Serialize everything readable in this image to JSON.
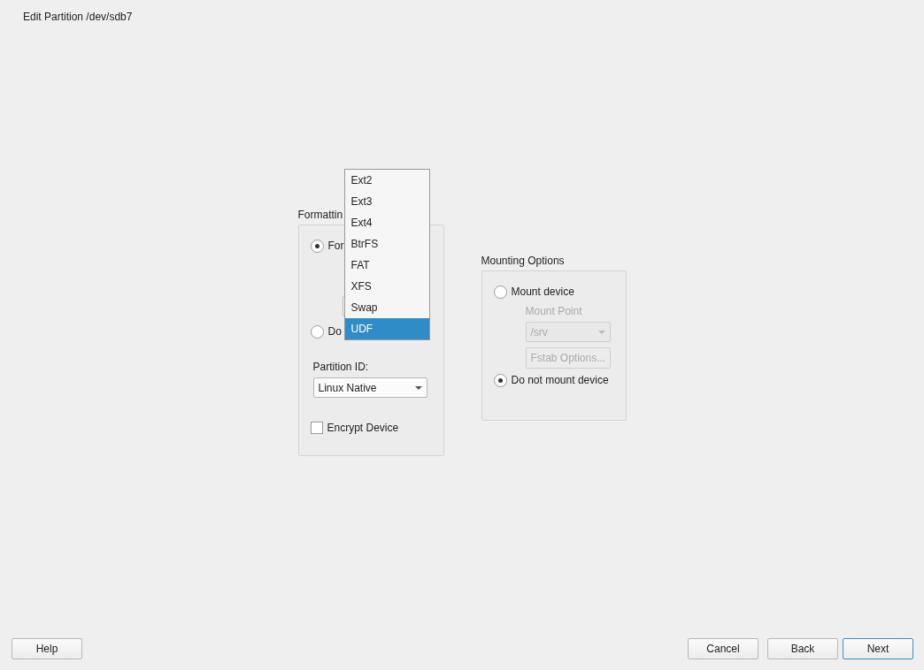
{
  "window": {
    "title": "Edit Partition /dev/sdb7"
  },
  "formatting": {
    "label": "Formattin",
    "options": [
      {
        "label": "For",
        "selected": true
      },
      {
        "label": "Do",
        "selected": false
      }
    ],
    "partition_id": {
      "label": "Partition ID:",
      "value": "Linux Native"
    },
    "encrypt": {
      "label": "Encrypt Device",
      "checked": false
    }
  },
  "filesystem_popup": {
    "items": [
      {
        "label": "Ext2",
        "selected": false
      },
      {
        "label": "Ext3",
        "selected": false
      },
      {
        "label": "Ext4",
        "selected": false
      },
      {
        "label": "BtrFS",
        "selected": false
      },
      {
        "label": "FAT",
        "selected": false
      },
      {
        "label": "XFS",
        "selected": false
      },
      {
        "label": "Swap",
        "selected": false
      },
      {
        "label": "UDF",
        "selected": true
      }
    ]
  },
  "mounting": {
    "label": "Mounting Options",
    "mount": {
      "label": "Mount device",
      "selected": false
    },
    "mount_point": {
      "label": "Mount Point",
      "value": "/srv",
      "disabled": true
    },
    "fstab_button": {
      "label": "Fstab Options...",
      "disabled": true
    },
    "no_mount": {
      "label": "Do not mount device",
      "selected": true
    }
  },
  "buttons": {
    "left": [
      {
        "label": "Help",
        "default": false
      }
    ],
    "right": [
      {
        "label": "Cancel",
        "default": false
      },
      {
        "label": "Back",
        "default": false
      },
      {
        "label": "Next",
        "default": true
      }
    ]
  }
}
